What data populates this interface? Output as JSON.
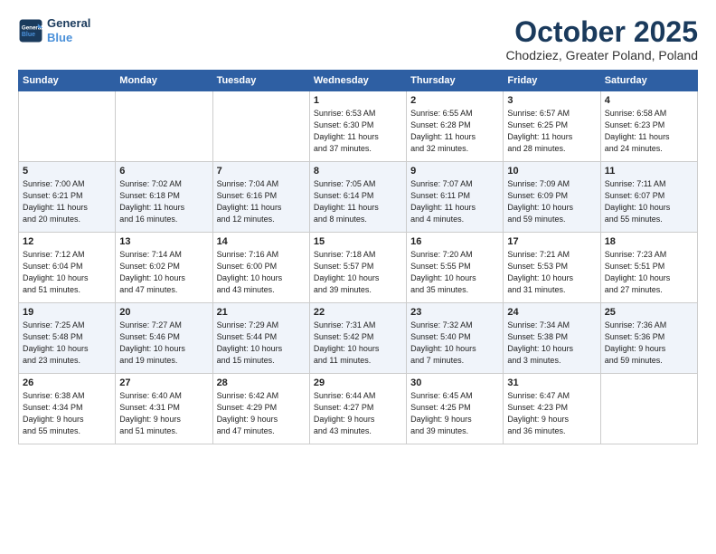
{
  "logo": {
    "line1": "General",
    "line2": "Blue"
  },
  "title": "October 2025",
  "subtitle": "Chodziez, Greater Poland, Poland",
  "days_header": [
    "Sunday",
    "Monday",
    "Tuesday",
    "Wednesday",
    "Thursday",
    "Friday",
    "Saturday"
  ],
  "weeks": [
    [
      {
        "day": "",
        "text": ""
      },
      {
        "day": "",
        "text": ""
      },
      {
        "day": "",
        "text": ""
      },
      {
        "day": "1",
        "text": "Sunrise: 6:53 AM\nSunset: 6:30 PM\nDaylight: 11 hours\nand 37 minutes."
      },
      {
        "day": "2",
        "text": "Sunrise: 6:55 AM\nSunset: 6:28 PM\nDaylight: 11 hours\nand 32 minutes."
      },
      {
        "day": "3",
        "text": "Sunrise: 6:57 AM\nSunset: 6:25 PM\nDaylight: 11 hours\nand 28 minutes."
      },
      {
        "day": "4",
        "text": "Sunrise: 6:58 AM\nSunset: 6:23 PM\nDaylight: 11 hours\nand 24 minutes."
      }
    ],
    [
      {
        "day": "5",
        "text": "Sunrise: 7:00 AM\nSunset: 6:21 PM\nDaylight: 11 hours\nand 20 minutes."
      },
      {
        "day": "6",
        "text": "Sunrise: 7:02 AM\nSunset: 6:18 PM\nDaylight: 11 hours\nand 16 minutes."
      },
      {
        "day": "7",
        "text": "Sunrise: 7:04 AM\nSunset: 6:16 PM\nDaylight: 11 hours\nand 12 minutes."
      },
      {
        "day": "8",
        "text": "Sunrise: 7:05 AM\nSunset: 6:14 PM\nDaylight: 11 hours\nand 8 minutes."
      },
      {
        "day": "9",
        "text": "Sunrise: 7:07 AM\nSunset: 6:11 PM\nDaylight: 11 hours\nand 4 minutes."
      },
      {
        "day": "10",
        "text": "Sunrise: 7:09 AM\nSunset: 6:09 PM\nDaylight: 10 hours\nand 59 minutes."
      },
      {
        "day": "11",
        "text": "Sunrise: 7:11 AM\nSunset: 6:07 PM\nDaylight: 10 hours\nand 55 minutes."
      }
    ],
    [
      {
        "day": "12",
        "text": "Sunrise: 7:12 AM\nSunset: 6:04 PM\nDaylight: 10 hours\nand 51 minutes."
      },
      {
        "day": "13",
        "text": "Sunrise: 7:14 AM\nSunset: 6:02 PM\nDaylight: 10 hours\nand 47 minutes."
      },
      {
        "day": "14",
        "text": "Sunrise: 7:16 AM\nSunset: 6:00 PM\nDaylight: 10 hours\nand 43 minutes."
      },
      {
        "day": "15",
        "text": "Sunrise: 7:18 AM\nSunset: 5:57 PM\nDaylight: 10 hours\nand 39 minutes."
      },
      {
        "day": "16",
        "text": "Sunrise: 7:20 AM\nSunset: 5:55 PM\nDaylight: 10 hours\nand 35 minutes."
      },
      {
        "day": "17",
        "text": "Sunrise: 7:21 AM\nSunset: 5:53 PM\nDaylight: 10 hours\nand 31 minutes."
      },
      {
        "day": "18",
        "text": "Sunrise: 7:23 AM\nSunset: 5:51 PM\nDaylight: 10 hours\nand 27 minutes."
      }
    ],
    [
      {
        "day": "19",
        "text": "Sunrise: 7:25 AM\nSunset: 5:48 PM\nDaylight: 10 hours\nand 23 minutes."
      },
      {
        "day": "20",
        "text": "Sunrise: 7:27 AM\nSunset: 5:46 PM\nDaylight: 10 hours\nand 19 minutes."
      },
      {
        "day": "21",
        "text": "Sunrise: 7:29 AM\nSunset: 5:44 PM\nDaylight: 10 hours\nand 15 minutes."
      },
      {
        "day": "22",
        "text": "Sunrise: 7:31 AM\nSunset: 5:42 PM\nDaylight: 10 hours\nand 11 minutes."
      },
      {
        "day": "23",
        "text": "Sunrise: 7:32 AM\nSunset: 5:40 PM\nDaylight: 10 hours\nand 7 minutes."
      },
      {
        "day": "24",
        "text": "Sunrise: 7:34 AM\nSunset: 5:38 PM\nDaylight: 10 hours\nand 3 minutes."
      },
      {
        "day": "25",
        "text": "Sunrise: 7:36 AM\nSunset: 5:36 PM\nDaylight: 9 hours\nand 59 minutes."
      }
    ],
    [
      {
        "day": "26",
        "text": "Sunrise: 6:38 AM\nSunset: 4:34 PM\nDaylight: 9 hours\nand 55 minutes."
      },
      {
        "day": "27",
        "text": "Sunrise: 6:40 AM\nSunset: 4:31 PM\nDaylight: 9 hours\nand 51 minutes."
      },
      {
        "day": "28",
        "text": "Sunrise: 6:42 AM\nSunset: 4:29 PM\nDaylight: 9 hours\nand 47 minutes."
      },
      {
        "day": "29",
        "text": "Sunrise: 6:44 AM\nSunset: 4:27 PM\nDaylight: 9 hours\nand 43 minutes."
      },
      {
        "day": "30",
        "text": "Sunrise: 6:45 AM\nSunset: 4:25 PM\nDaylight: 9 hours\nand 39 minutes."
      },
      {
        "day": "31",
        "text": "Sunrise: 6:47 AM\nSunset: 4:23 PM\nDaylight: 9 hours\nand 36 minutes."
      },
      {
        "day": "",
        "text": ""
      }
    ]
  ]
}
